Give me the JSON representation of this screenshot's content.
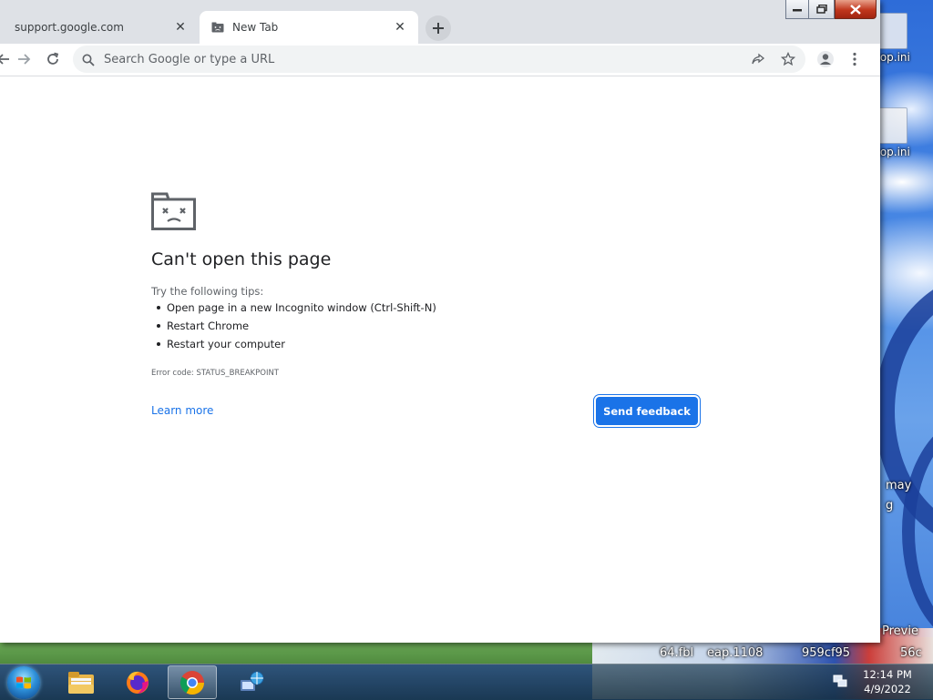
{
  "browser": {
    "tabs": [
      {
        "label": "support.google.com",
        "active": false
      },
      {
        "label": "New Tab",
        "active": true
      }
    ],
    "omnibox_placeholder": "Search Google or type a URL"
  },
  "error_page": {
    "title": "Can't open this page",
    "tips_intro": "Try the following tips:",
    "tips": [
      "Open page in a new Incognito window (Ctrl-Shift-N)",
      "Restart Chrome",
      "Restart your computer"
    ],
    "error_code": "Error code: STATUS_BREAKPOINT",
    "learn_more": "Learn more",
    "send_feedback": "Send feedback"
  },
  "desktop": {
    "icons": [
      "top.ini",
      "top.ini"
    ],
    "fragments": [
      "may",
      "g",
      "Previe",
      "64.fbl",
      "eap.1108",
      "959cf95",
      "56c"
    ]
  },
  "taskbar": {
    "apps": [
      "windows-explorer",
      "firefox",
      "chrome",
      "network-app"
    ],
    "clock_time": "12:14 PM",
    "clock_date": "4/9/2022"
  },
  "colors": {
    "accent": "#1a73e8",
    "tabstrip": "#dee1e6",
    "omnibox": "#f1f3f4",
    "error_title": "#202124"
  }
}
